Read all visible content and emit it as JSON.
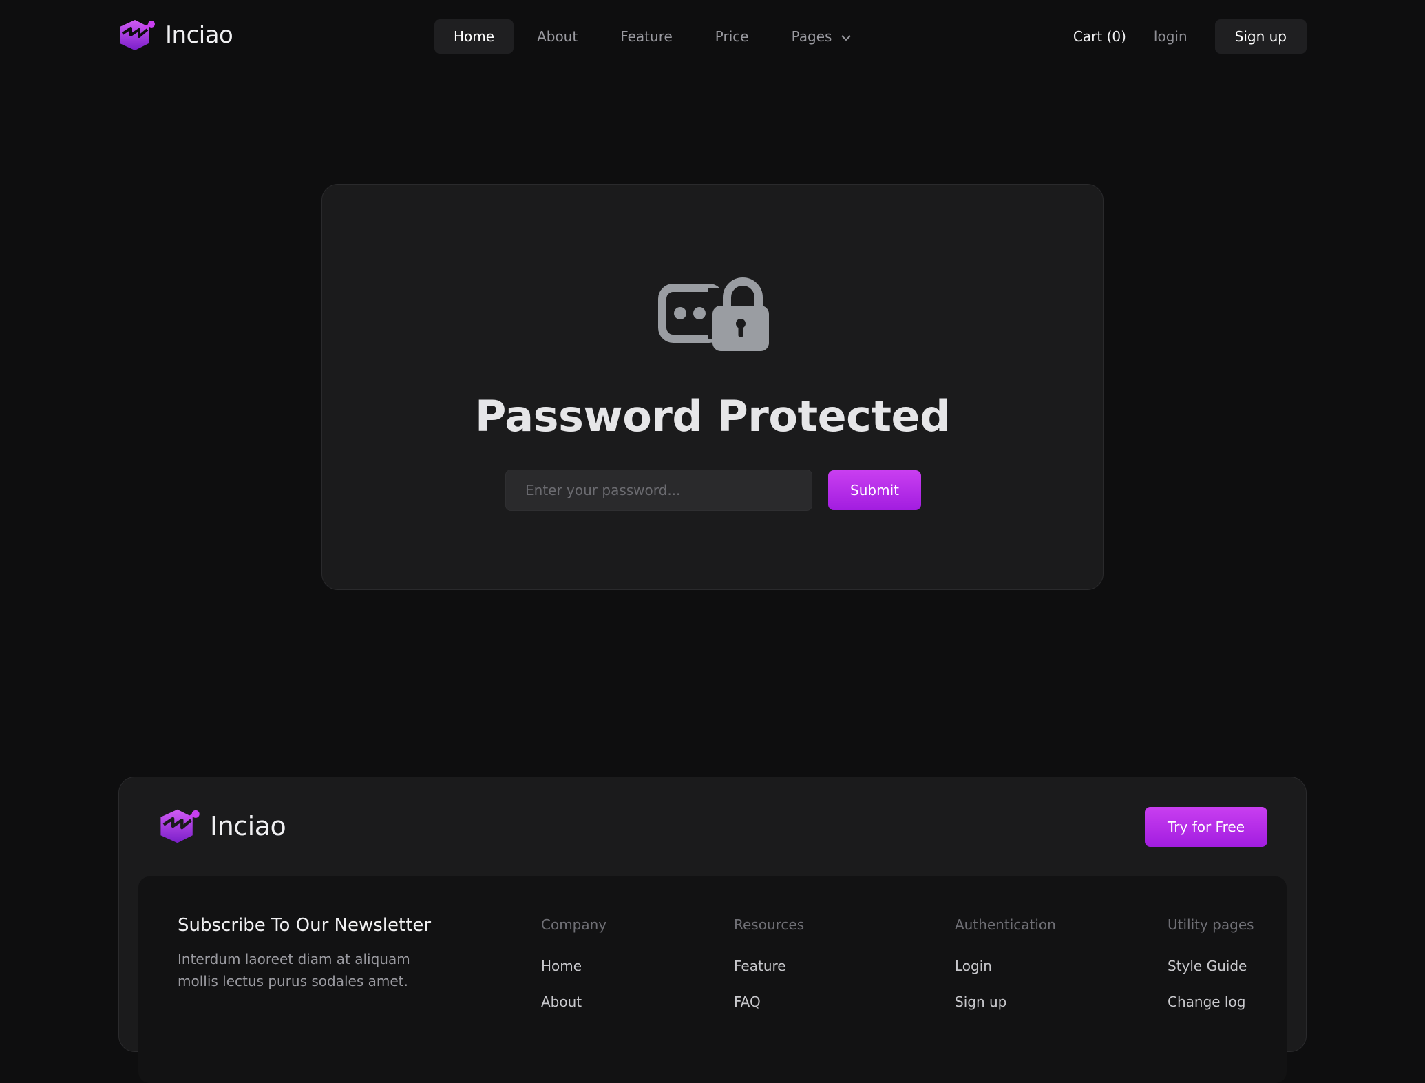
{
  "brand": {
    "name": "Inciao"
  },
  "nav": {
    "items": [
      {
        "label": "Home",
        "active": true
      },
      {
        "label": "About"
      },
      {
        "label": "Feature"
      },
      {
        "label": "Price"
      },
      {
        "label": "Pages",
        "has_dropdown": true
      }
    ],
    "cart_label": "Cart (0)",
    "login_label": "login",
    "signup_label": "Sign up"
  },
  "protected": {
    "icon": "password-lock-icon",
    "title": "Password Protected",
    "password_placeholder": "Enter your password...",
    "password_value": "",
    "submit_label": "Submit"
  },
  "footer": {
    "brand_name": "Inciao",
    "cta_label": "Try for Free",
    "newsletter_title": "Subscribe To Our Newsletter",
    "newsletter_desc": "Interdum laoreet diam at aliquam mollis lectus purus sodales amet.",
    "columns": [
      {
        "heading": "Company",
        "links": [
          "Home",
          "About"
        ]
      },
      {
        "heading": "Resources",
        "links": [
          "Feature",
          "FAQ"
        ]
      },
      {
        "heading": "Authentication",
        "links": [
          "Login",
          "Sign up"
        ]
      },
      {
        "heading": "Utility pages",
        "links": [
          "Style Guide",
          "Change log"
        ]
      }
    ]
  },
  "colors": {
    "background": "#0e0e0f",
    "card": "#1b1b1c",
    "accent_top": "#c93ff0",
    "accent_bottom": "#a21de0"
  }
}
